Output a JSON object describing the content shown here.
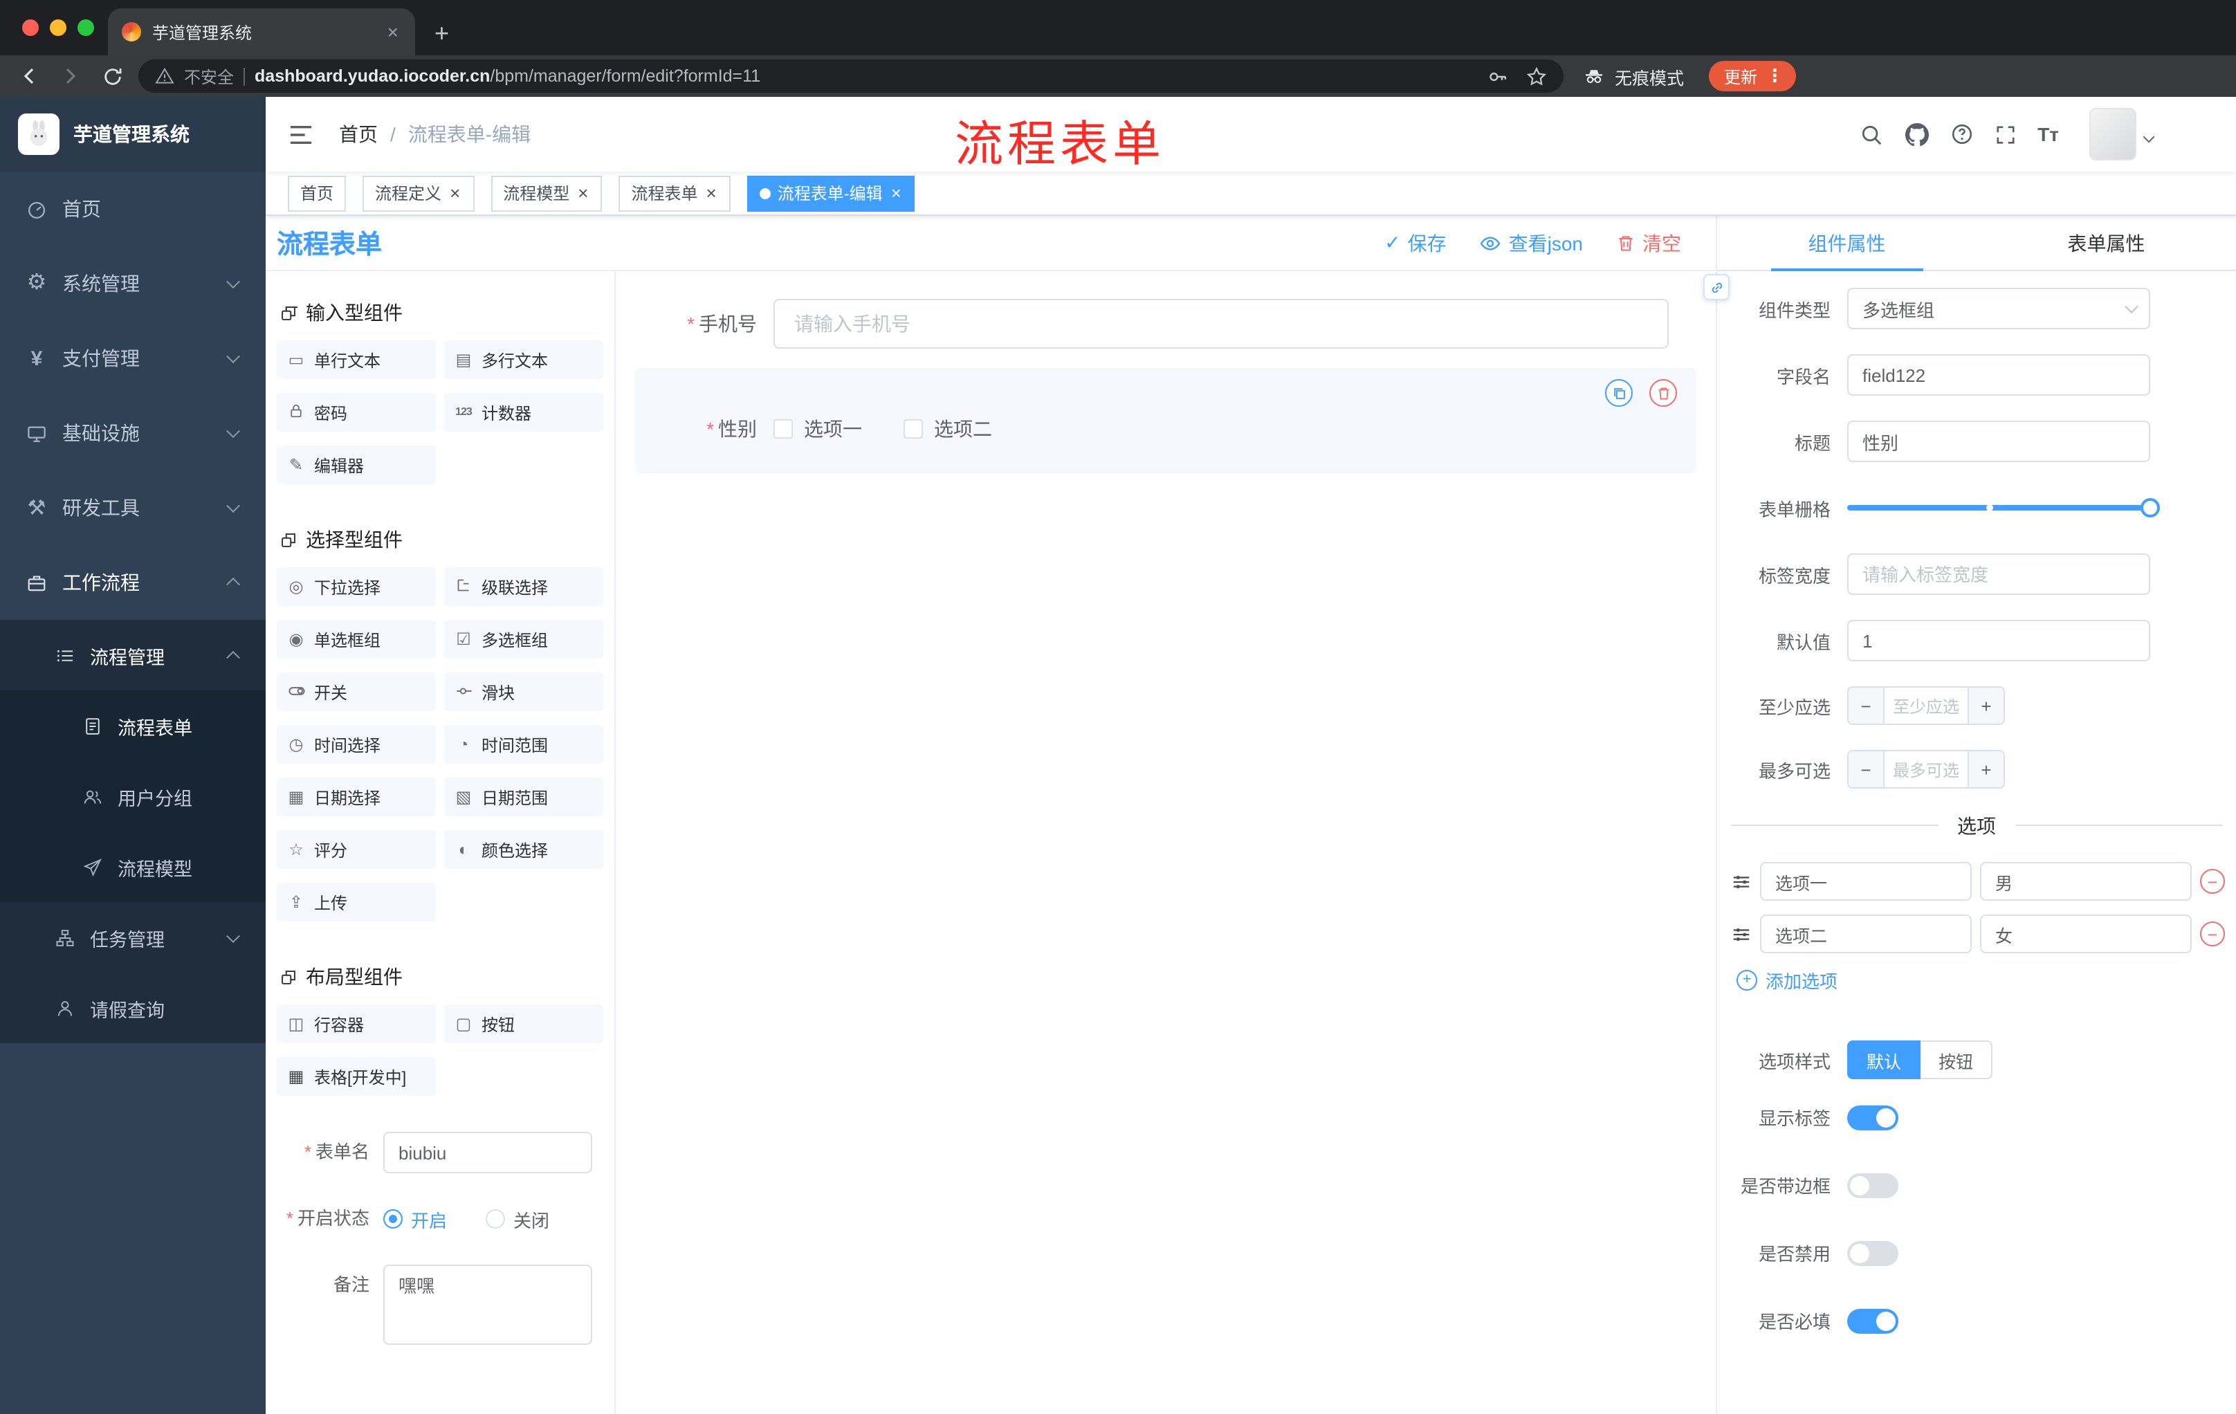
{
  "glyphs": {
    "close": "×",
    "plus": "+",
    "minus": "−",
    "kebab": "⋮",
    "check": "✓",
    "asterisk": "*",
    "slash": "/",
    "font_size": "Tт",
    "gear": "⚙",
    "yen": "¥",
    "hammer": "⚒",
    "rect": "▭",
    "lines": "▤",
    "counter": "123",
    "pencil": "✎",
    "bullseye": "◎",
    "radio": "◉",
    "checkbox": "☑",
    "clock": "◷",
    "clock2": "◔",
    "grid": "▦",
    "grid2": "▧",
    "star": "☆",
    "half": "◐",
    "upload": "⇪",
    "column": "◫",
    "button": "▢"
  },
  "colors": {
    "accent": "#409EFF",
    "danger": "#F56C6C",
    "update_pill": "#E8593C",
    "sidebar_bg": "#304156",
    "submenu_bg": "#1F2D3D",
    "annotation_red": "#FE2B25",
    "component_item_bg": "#F6F7FF"
  },
  "browser": {
    "tab_title": "芋道管理系统",
    "security_label": "不安全",
    "url_domain": "dashboard.yudao.iocoder.cn",
    "url_path": "/bpm/manager/form/edit?formId=11",
    "incognito_label": "无痕模式",
    "update_label": "更新"
  },
  "annotation": {
    "text": "流程表单"
  },
  "sidebar": {
    "title": "芋道管理系统",
    "menu": [
      {
        "label": "首页"
      },
      {
        "label": "系统管理"
      },
      {
        "label": "支付管理"
      },
      {
        "label": "基础设施"
      },
      {
        "label": "研发工具"
      },
      {
        "label": "工作流程"
      },
      {
        "label": "流程管理"
      },
      {
        "label": "流程表单"
      },
      {
        "label": "用户分组"
      },
      {
        "label": "流程模型"
      },
      {
        "label": "任务管理"
      },
      {
        "label": "请假查询"
      }
    ]
  },
  "navbar": {
    "breadcrumb_home": "首页",
    "breadcrumb_current": "流程表单-编辑"
  },
  "tags": [
    {
      "label": "首页"
    },
    {
      "label": "流程定义"
    },
    {
      "label": "流程模型"
    },
    {
      "label": "流程表单"
    },
    {
      "label": "流程表单-编辑"
    }
  ],
  "editor": {
    "title": "流程表单",
    "save": "保存",
    "view_json": "查看json",
    "clear": "清空",
    "groups": {
      "input": {
        "title": "输入型组件",
        "items": [
          "单行文本",
          "多行文本",
          "密码",
          "计数器",
          "编辑器"
        ]
      },
      "select": {
        "title": "选择型组件",
        "items": [
          "下拉选择",
          "级联选择",
          "单选框组",
          "多选框组",
          "开关",
          "滑块",
          "时间选择",
          "时间范围",
          "日期选择",
          "日期范围",
          "评分",
          "颜色选择",
          "上传"
        ]
      },
      "layout": {
        "title": "布局型组件",
        "items": [
          "行容器",
          "按钮",
          "表格[开发中]"
        ]
      }
    },
    "meta": {
      "name_label": "表单名",
      "name_value": "biubiu",
      "status_label": "开启状态",
      "status_on": "开启",
      "status_off": "关闭",
      "remark_label": "备注",
      "remark_value": "嘿嘿"
    },
    "canvas": {
      "phone_label": "手机号",
      "phone_placeholder": "请输入手机号",
      "gender_label": "性别",
      "gender_opt1": "选项一",
      "gender_opt2": "选项二"
    }
  },
  "props": {
    "tab_component": "组件属性",
    "tab_form": "表单属性",
    "type_label": "组件类型",
    "type_value": "多选框组",
    "field_label": "字段名",
    "field_value": "field122",
    "title_label": "标题",
    "title_value": "性别",
    "grid_label": "表单栅格",
    "width_label": "标签宽度",
    "width_placeholder": "请输入标签宽度",
    "default_label": "默认值",
    "default_value": "1",
    "min_label": "至少应选",
    "min_placeholder": "至少应选",
    "max_label": "最多可选",
    "max_placeholder": "最多可选",
    "options_title": "选项",
    "options": [
      {
        "label": "选项一",
        "value": "男"
      },
      {
        "label": "选项二",
        "value": "女"
      }
    ],
    "add_option": "添加选项",
    "style_label": "选项样式",
    "style_default": "默认",
    "style_button": "按钮",
    "show_label": "显示标签",
    "show_on": true,
    "border_label": "是否带边框",
    "border_on": false,
    "disabled_label": "是否禁用",
    "disabled_on": false,
    "required_label": "是否必填",
    "required_on": true
  }
}
